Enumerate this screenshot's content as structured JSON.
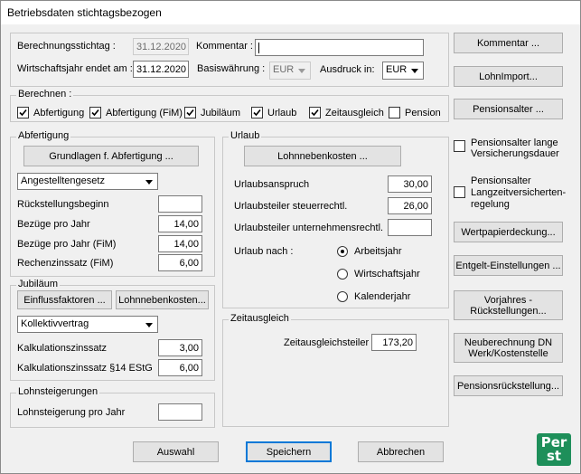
{
  "window": {
    "title": "Betriebsdaten stichtagsbezogen"
  },
  "top": {
    "stichtag_label": "Berechnungsstichtag :",
    "stichtag_value": "31.12.2020",
    "kommentar_label": "Kommentar :",
    "kommentar_value": "",
    "wj_label": "Wirtschaftsjahr endet am :",
    "wj_value": "31.12.2020",
    "basis_label": "Basiswährung :",
    "basis_value": "EUR",
    "ausdruck_label": "Ausdruck in:",
    "ausdruck_value": "EUR"
  },
  "berechnen": {
    "title": "Berechnen :",
    "items": [
      {
        "label": "Abfertigung",
        "checked": true
      },
      {
        "label": "Abfertigung (FiM)",
        "checked": true
      },
      {
        "label": "Jubiläum",
        "checked": true
      },
      {
        "label": "Urlaub",
        "checked": true
      },
      {
        "label": "Zeitausgleich",
        "checked": true
      },
      {
        "label": "Pension",
        "checked": false
      }
    ]
  },
  "abfertigung": {
    "title": "Abfertigung",
    "grundlagen_button": "Grundlagen f. Abfertigung ...",
    "gesetz_value": "Angestelltengesetz",
    "rows": [
      {
        "label": "Rückstellungsbeginn",
        "value": ""
      },
      {
        "label": "Bezüge pro Jahr",
        "value": "14,00"
      },
      {
        "label": "Bezüge pro Jahr (FiM)",
        "value": "14,00"
      },
      {
        "label": "Rechenzinssatz (FiM)",
        "value": "6,00"
      }
    ]
  },
  "jubilaeum": {
    "title": "Jubiläum",
    "einfluss_button": "Einflussfaktoren ...",
    "lohnneben_button": "Lohnnebenkosten...",
    "vertrag_value": "Kollektivvertrag",
    "rows": [
      {
        "label": "Kalkulationszinssatz",
        "value": "3,00"
      },
      {
        "label": "Kalkulationszinssatz §14 EStG",
        "value": "6,00"
      }
    ]
  },
  "lohnsteigerungen": {
    "title": "Lohnsteigerungen",
    "label": "Lohnsteigerung pro Jahr",
    "value": ""
  },
  "urlaub": {
    "title": "Urlaub",
    "lohnneben_button": "Lohnnebenkosten ...",
    "rows": [
      {
        "label": "Urlaubsanspruch",
        "value": "30,00"
      },
      {
        "label": "Urlaubsteiler steuerrechtl.",
        "value": "26,00"
      },
      {
        "label": "Urlaubsteiler unternehmensrechtl.",
        "value": ""
      }
    ],
    "nach_label": "Urlaub nach :",
    "options": [
      {
        "label": "Arbeitsjahr",
        "selected": true
      },
      {
        "label": "Wirtschaftsjahr",
        "selected": false
      },
      {
        "label": "Kalenderjahr",
        "selected": false
      }
    ]
  },
  "zeitausgleich": {
    "title": "Zeitausgleich",
    "label": "Zeitausgleichsteiler",
    "value": "173,20"
  },
  "right": {
    "kommentar_button": "Kommentar ...",
    "lohnimport_button": "LohnImport...",
    "pensionsalter_button": "Pensionsalter ...",
    "cb1_line1": "Pensionsalter lange",
    "cb1_line2": "Versicherungsdauer",
    "cb2_line1": "Pensionsalter",
    "cb2_line2": "Langzeitversicherten-",
    "cb2_line3": "regelung",
    "wertpapier_button": "Wertpapierdeckung...",
    "entgelt_button": "Entgelt-Einstellungen ...",
    "vorjahres_line1": "Vorjahres -",
    "vorjahres_line2": "Rückstellungen...",
    "neuber_line1": "Neuberechnung DN",
    "neuber_line2": "Werk/Kostenstelle",
    "pensionsrueck_button": "Pensionsrückstellung..."
  },
  "bottom": {
    "auswahl": "Auswahl",
    "speichern": "Speichern",
    "abbrechen": "Abbrechen"
  },
  "logo": {
    "line1": "Per",
    "line2": "st",
    "color": "#1e8f5a"
  }
}
